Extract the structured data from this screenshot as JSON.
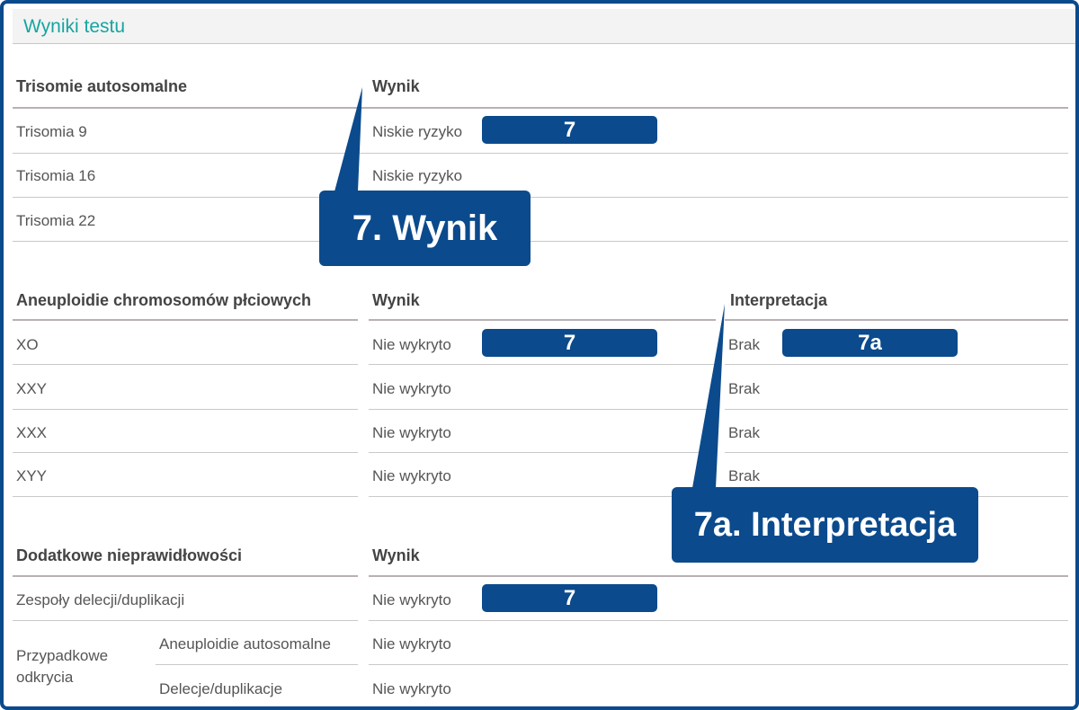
{
  "header": {
    "title": "Wyniki testu"
  },
  "trisomies": {
    "heading": "Trisomie autosomalne",
    "result_heading": "Wynik",
    "rows": [
      {
        "name": "Trisomia 9",
        "result": "Niskie ryzyko"
      },
      {
        "name": "Trisomia 16",
        "result": "Niskie ryzyko"
      },
      {
        "name": "Trisomia 22",
        "result": ""
      }
    ],
    "badge": "7"
  },
  "sex_chromosomes": {
    "heading": "Aneuploidie chromosomów płciowych",
    "result_heading": "Wynik",
    "interp_heading": "Interpretacja",
    "rows": [
      {
        "name": "XO",
        "result": "Nie wykryto",
        "interp": "Brak"
      },
      {
        "name": "XXY",
        "result": "Nie wykryto",
        "interp": "Brak"
      },
      {
        "name": "XXX",
        "result": "Nie wykryto",
        "interp": "Brak"
      },
      {
        "name": "XYY",
        "result": "Nie wykryto",
        "interp": "Brak"
      }
    ],
    "badge_result": "7",
    "badge_interp": "7a"
  },
  "additional": {
    "heading": "Dodatkowe nieprawidłowości",
    "result_heading": "Wynik",
    "row_main": {
      "name": "Zespoły delecji/duplikacji",
      "result": "Nie wykryto"
    },
    "incidental_label": "Przypadkowe odkrycia",
    "sub_rows": [
      {
        "name": "Aneuploidie autosomalne",
        "result": "Nie wykryto"
      },
      {
        "name": "Delecje/duplikacje",
        "result": "Nie wykryto"
      }
    ],
    "badge": "7"
  },
  "callouts": {
    "wynik": "7. Wynik",
    "interpretacja": "7a. Interpretacja"
  },
  "colors": {
    "accent_blue": "#0b4a8c",
    "title_teal": "#16a5a0"
  }
}
